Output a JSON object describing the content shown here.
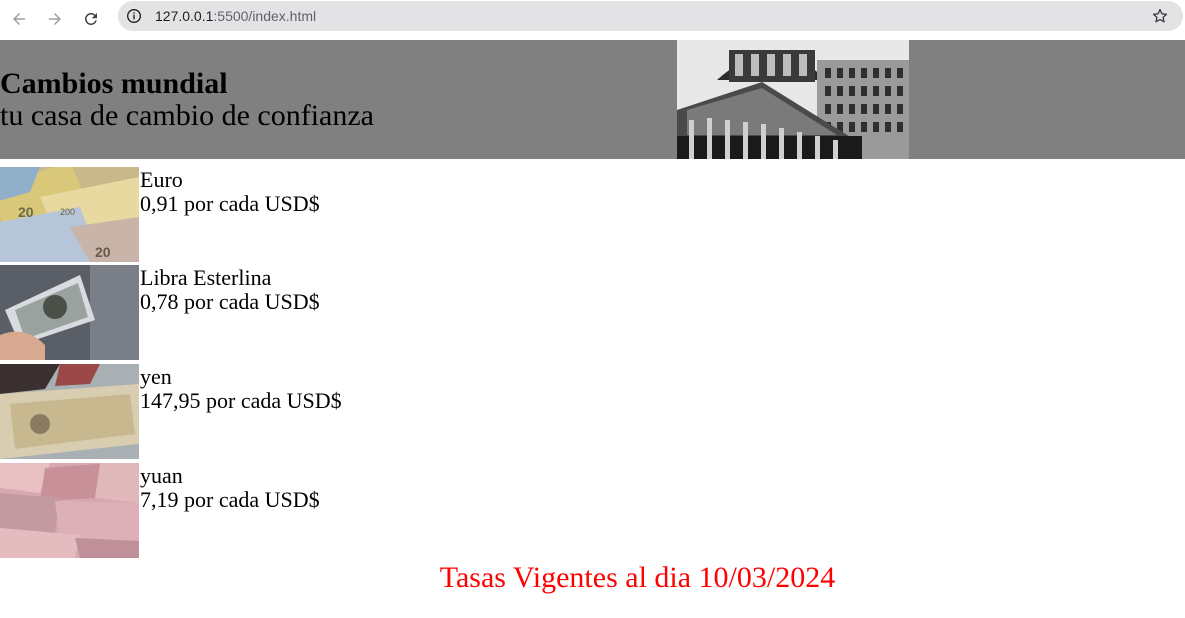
{
  "browser": {
    "url_host": "127.0.0.1",
    "url_path": ":5500/index.html",
    "icons": [
      "back-arrow-icon",
      "forward-arrow-icon",
      "reload-icon",
      "info-icon",
      "bookmark-star-icon"
    ]
  },
  "header": {
    "title": "Cambios mundial",
    "subtitle": "tu casa de cambio de confianza",
    "background_color": "#808080"
  },
  "currencies": [
    {
      "name": "Euro",
      "rate": "0,91 por cada USD$"
    },
    {
      "name": "Libra Esterlina",
      "rate": "0,78 por cada USD$"
    },
    {
      "name": "yen",
      "rate": "147,95 por cada USD$"
    },
    {
      "name": "yuan",
      "rate": "7,19 por cada USD$"
    }
  ],
  "footer": {
    "note": "Tasas Vigentes al dia 10/03/2024",
    "color": "#ff0000"
  }
}
